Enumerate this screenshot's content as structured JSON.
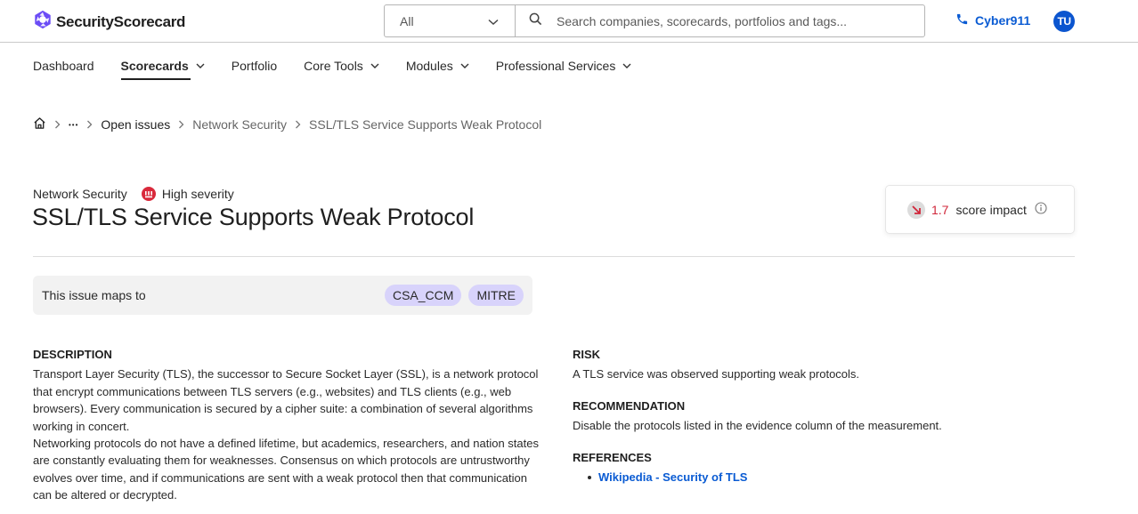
{
  "header": {
    "brand": "SecurityScorecard",
    "search_scope": "All",
    "search_placeholder": "Search companies, scorecards, portfolios and tags...",
    "search_value": "",
    "hotline_label": "Cyber911",
    "avatar_initials": "TU"
  },
  "nav": {
    "items": [
      {
        "label": "Dashboard",
        "dropdown": false,
        "active": false
      },
      {
        "label": "Scorecards",
        "dropdown": true,
        "active": true
      },
      {
        "label": "Portfolio",
        "dropdown": false,
        "active": false
      },
      {
        "label": "Core Tools",
        "dropdown": true,
        "active": false
      },
      {
        "label": "Modules",
        "dropdown": true,
        "active": false
      },
      {
        "label": "Professional Services",
        "dropdown": true,
        "active": false
      }
    ]
  },
  "breadcrumb": {
    "home_icon": "home-icon",
    "ellipsis": "•••",
    "items": [
      "Open issues",
      "Network Security",
      "SSL/TLS Service Supports Weak Protocol"
    ]
  },
  "issue": {
    "category": "Network Security",
    "severity": "High severity",
    "title": "SSL/TLS Service Supports Weak Protocol",
    "score_impact_value": "1.7",
    "score_impact_label": "score impact"
  },
  "mapping": {
    "label": "This issue maps to",
    "tags": [
      "CSA_CCM",
      "MITRE"
    ]
  },
  "description": {
    "heading": "DESCRIPTION",
    "paragraphs": [
      "Transport Layer Security (TLS), the successor to Secure Socket Layer (SSL), is a network protocol that encrypt communications between TLS servers (e.g., websites) and TLS clients (e.g., web browsers). Every communication is secured by a cipher suite: a combination of several algorithms working in concert.",
      "Networking protocols do not have a defined lifetime, but academics, researchers, and nation states are constantly evaluating them for weaknesses. Consensus on which protocols are untrustworthy evolves over time, and if communications are sent with a weak protocol then that communication can be altered or decrypted."
    ]
  },
  "risk": {
    "heading": "RISK",
    "text": "A TLS service was observed supporting weak protocols."
  },
  "recommendation": {
    "heading": "RECOMMENDATION",
    "text": "Disable the protocols listed in the evidence column of the measurement."
  },
  "references": {
    "heading": "REFERENCES",
    "links": [
      "Wikipedia - Security of TLS"
    ]
  },
  "colors": {
    "brand": "#6b4cf6",
    "link": "#0a5bd3",
    "severity_high": "#d9293b",
    "tag_bg": "#d8d3fb"
  }
}
